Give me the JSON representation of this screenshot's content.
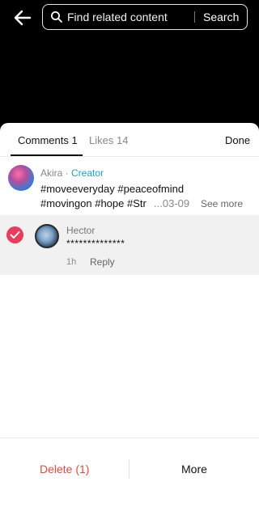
{
  "header": {
    "search_placeholder": "Find related content",
    "search_button": "Search"
  },
  "tabs": {
    "comments": "Comments 1",
    "likes": "Likes 14",
    "done": "Done"
  },
  "post": {
    "author": "Akira",
    "separator": " · ",
    "role": "Creator",
    "line1": "#moveeveryday #peaceofmind",
    "line2": "#movingon #hope #Str",
    "date": "...03-09",
    "see_more": "See more"
  },
  "comment": {
    "name": "Hector",
    "text": "**************",
    "time": "1h",
    "reply": "Reply",
    "selected": true
  },
  "actions": {
    "delete": "Delete (1)",
    "more": "More"
  },
  "colors": {
    "accent_red": "#ea3b5a",
    "delete_red": "#e2493f",
    "creator_blue": "#1da1c8"
  }
}
